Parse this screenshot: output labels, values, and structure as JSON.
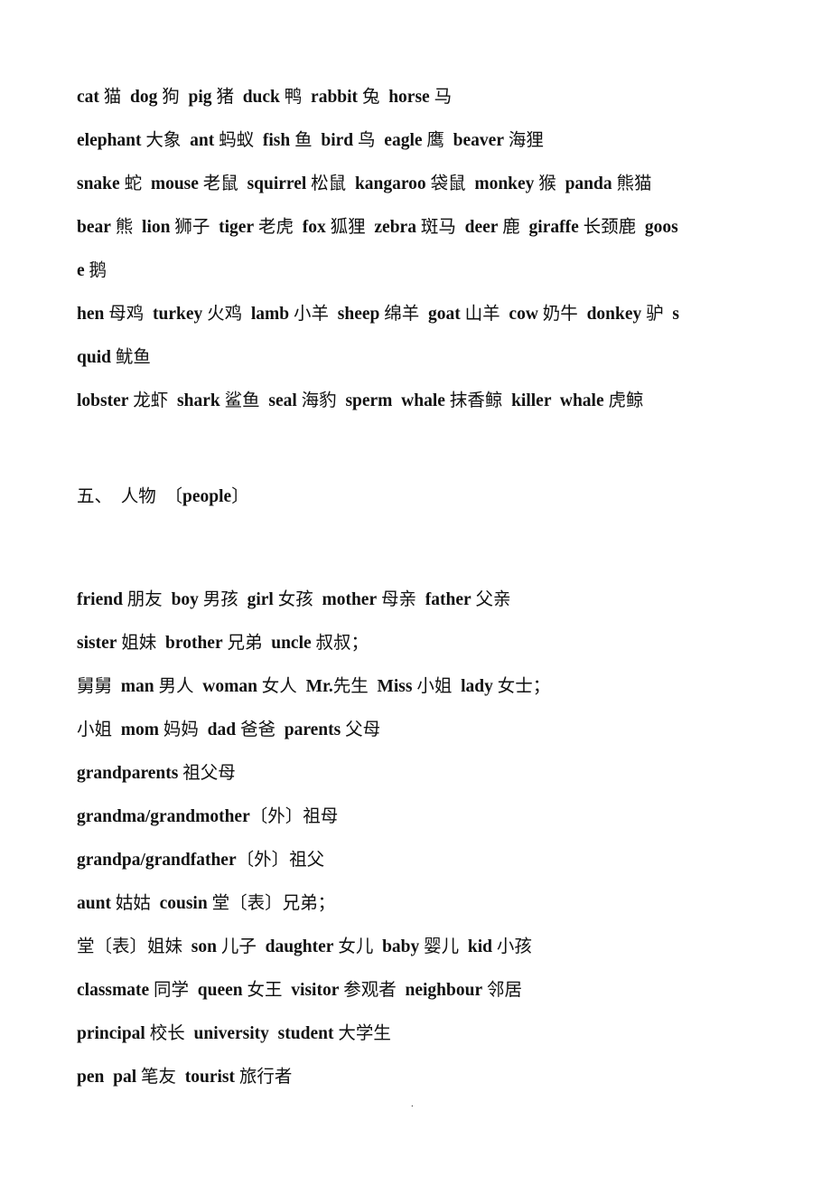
{
  "document": {
    "language": "zh-CN + en",
    "animals_section": {
      "lines": [
        [
          {
            "en": "cat",
            "cn": "猫"
          },
          {
            "en": "dog",
            "cn": "狗"
          },
          {
            "en": "pig",
            "cn": "猪"
          },
          {
            "en": "duck",
            "cn": "鸭"
          },
          {
            "en": "rabbit",
            "cn": "兔"
          },
          {
            "en": "horse",
            "cn": "马"
          }
        ],
        [
          {
            "en": "elephant",
            "cn": "大象"
          },
          {
            "en": "ant",
            "cn": "蚂蚁"
          },
          {
            "en": "fish",
            "cn": "鱼"
          },
          {
            "en": "bird",
            "cn": "鸟"
          },
          {
            "en": "eagle",
            "cn": "鹰"
          },
          {
            "en": "beaver",
            "cn": "海狸"
          }
        ],
        [
          {
            "en": "snake",
            "cn": "蛇"
          },
          {
            "en": "mouse",
            "cn": "老鼠"
          },
          {
            "en": "squirrel",
            "cn": "松鼠"
          },
          {
            "en": "kangaroo",
            "cn": "袋鼠"
          },
          {
            "en": "monkey",
            "cn": "猴"
          },
          {
            "en": "panda",
            "cn": "熊猫"
          }
        ],
        [
          {
            "en": "bear",
            "cn": "熊"
          },
          {
            "en": "lion",
            "cn": "狮子"
          },
          {
            "en": "tiger",
            "cn": "老虎"
          },
          {
            "en": "fox",
            "cn": "狐狸"
          },
          {
            "en": "zebra",
            "cn": "斑马"
          },
          {
            "en": "deer",
            "cn": "鹿"
          },
          {
            "en": "giraffe",
            "cn": "长颈鹿"
          },
          {
            "en": "goos",
            "cn": ""
          }
        ],
        [
          {
            "en": "e",
            "cn": "鹅"
          }
        ],
        [
          {
            "en": "hen",
            "cn": "母鸡"
          },
          {
            "en": "turkey",
            "cn": "火鸡"
          },
          {
            "en": "lamb",
            "cn": "小羊"
          },
          {
            "en": "sheep",
            "cn": "绵羊"
          },
          {
            "en": "goat",
            "cn": "山羊"
          },
          {
            "en": "cow",
            "cn": "奶牛"
          },
          {
            "en": "donkey",
            "cn": "驴"
          },
          {
            "en": "s",
            "cn": ""
          }
        ],
        [
          {
            "en": "quid",
            "cn": "鱿鱼"
          }
        ],
        [
          {
            "en": "lobster",
            "cn": "龙虾"
          },
          {
            "en": "shark",
            "cn": "鲨鱼"
          },
          {
            "en": "seal",
            "cn": "海豹"
          },
          {
            "en": "sperm  whale",
            "cn": "抹香鲸"
          },
          {
            "en": "killer  whale",
            "cn": "虎鲸"
          }
        ]
      ]
    },
    "heading": {
      "number": "五、",
      "chinese": "人物",
      "bracket_open": "〔",
      "english": "people",
      "bracket_close": "〕"
    },
    "people_section": {
      "lines": [
        [
          {
            "en": "friend",
            "cn": "朋友"
          },
          {
            "en": "boy",
            "cn": "男孩"
          },
          {
            "en": "girl",
            "cn": "女孩"
          },
          {
            "en": "mother",
            "cn": "母亲"
          },
          {
            "en": "father",
            "cn": "父亲"
          }
        ],
        [
          {
            "en": "sister",
            "cn": "姐妹"
          },
          {
            "en": "brother",
            "cn": "兄弟"
          },
          {
            "en": "uncle",
            "cn": "叔叔；"
          }
        ],
        [
          {
            "en": "",
            "cn": "舅舅"
          },
          {
            "en": "man",
            "cn": "男人"
          },
          {
            "en": "woman",
            "cn": "女人"
          },
          {
            "en": "Mr.",
            "cn": "先生",
            "tight": true
          },
          {
            "en": "Miss",
            "cn": "小姐"
          },
          {
            "en": "lady",
            "cn": "女士；"
          }
        ],
        [
          {
            "en": "",
            "cn": "小姐"
          },
          {
            "en": "mom",
            "cn": "妈妈"
          },
          {
            "en": "dad",
            "cn": "爸爸"
          },
          {
            "en": "parents",
            "cn": "父母"
          }
        ],
        [
          {
            "en": "grandparents",
            "cn": "祖父母"
          }
        ],
        [
          {
            "en": "grandma/grandmother",
            "cn": "〔外〕祖母",
            "tight": true
          }
        ],
        [
          {
            "en": "grandpa/grandfather",
            "cn": "〔外〕祖父",
            "tight": true
          }
        ],
        [
          {
            "en": "aunt",
            "cn": "姑姑"
          },
          {
            "en": "cousin",
            "cn": "堂〔表〕兄弟；"
          }
        ],
        [
          {
            "en": "",
            "cn": "堂〔表〕姐妹"
          },
          {
            "en": "son",
            "cn": "儿子"
          },
          {
            "en": "daughter",
            "cn": "女儿"
          },
          {
            "en": "baby",
            "cn": "婴儿"
          },
          {
            "en": "kid",
            "cn": "小孩"
          }
        ],
        [
          {
            "en": "classmate",
            "cn": "同学"
          },
          {
            "en": "queen",
            "cn": "女王"
          },
          {
            "en": "visitor",
            "cn": "参观者"
          },
          {
            "en": "neighbour",
            "cn": "邻居"
          }
        ],
        [
          {
            "en": "principal",
            "cn": "校长"
          },
          {
            "en": "university  student",
            "cn": "大学生"
          }
        ],
        [
          {
            "en": "pen  pal",
            "cn": "笔友"
          },
          {
            "en": "tourist",
            "cn": "旅行者"
          }
        ]
      ]
    },
    "footer": {
      "page_mark": "."
    }
  }
}
